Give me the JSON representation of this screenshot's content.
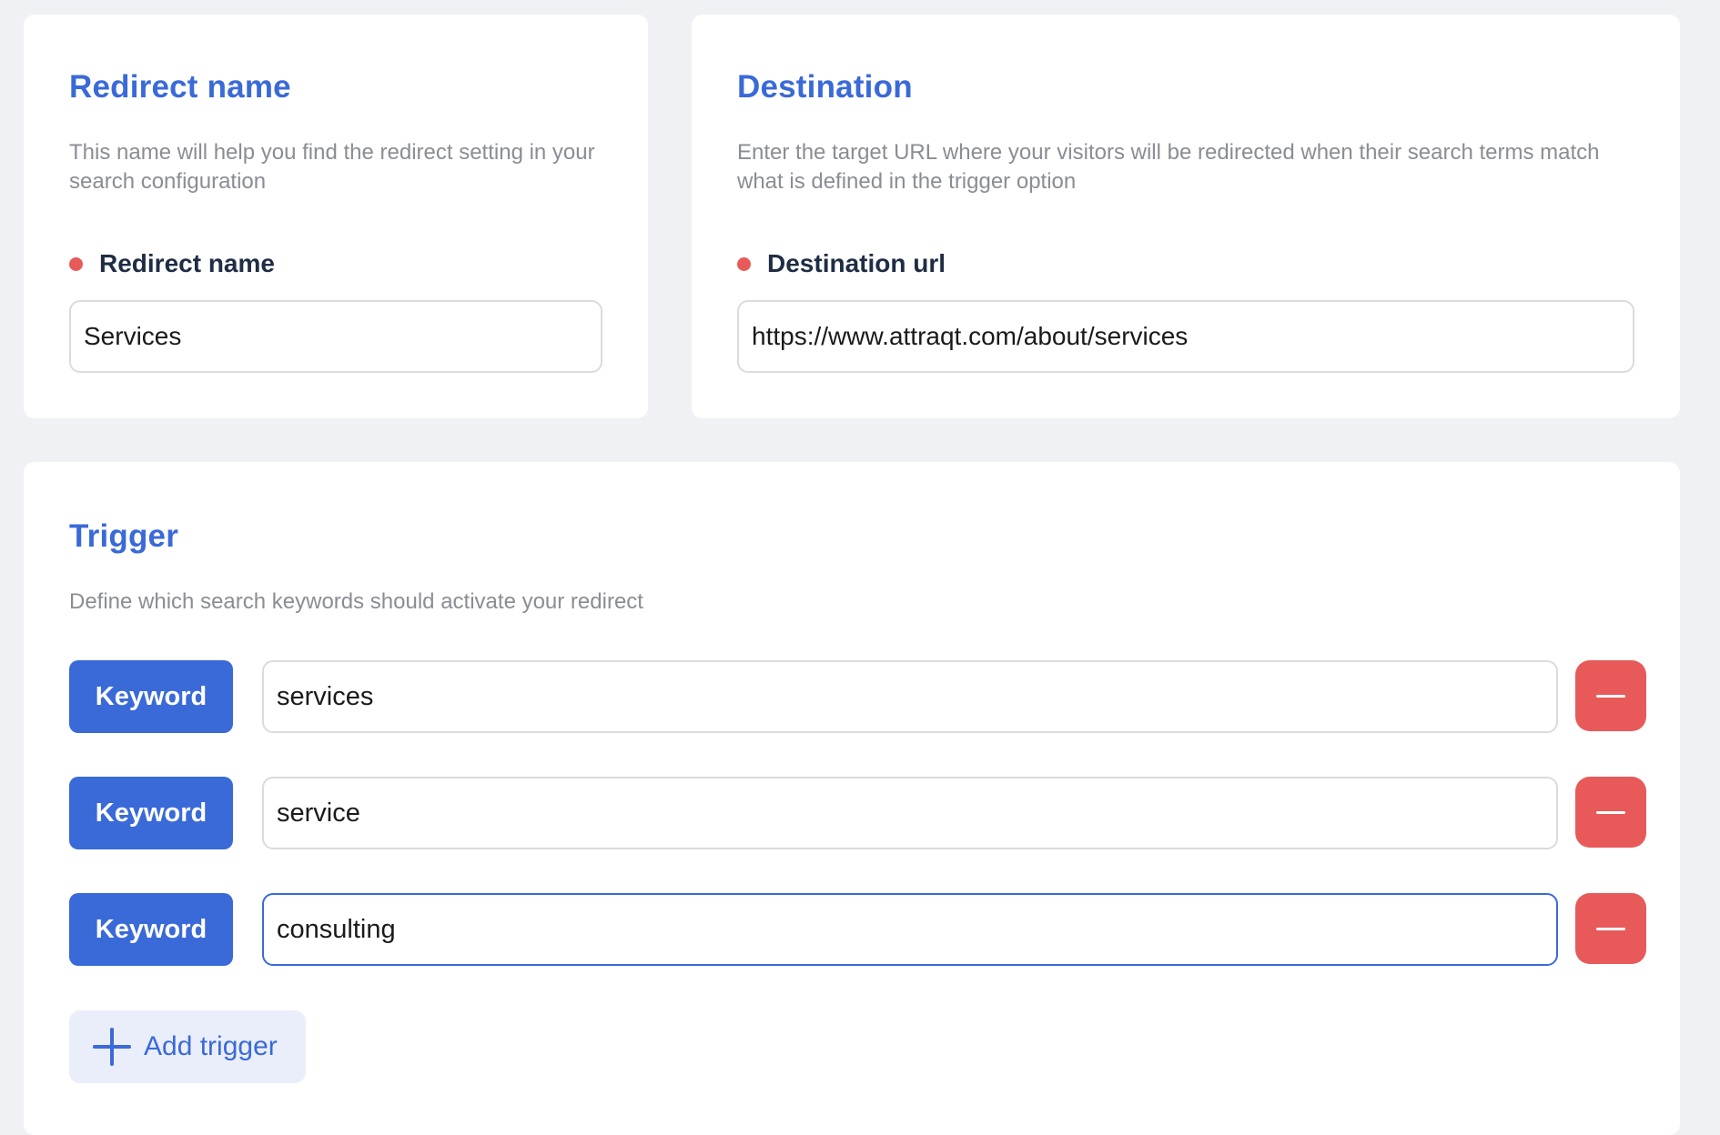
{
  "redirect_name_card": {
    "title": "Redirect name",
    "description": "This name will help you find the redirect setting in your search configuration",
    "field_label": "Redirect name",
    "value": "Services"
  },
  "destination_card": {
    "title": "Destination",
    "description": "Enter the target URL where your visitors will be redirected when their search terms match what is defined in the trigger option",
    "field_label": "Destination url",
    "value": "https://www.attraqt.com/about/services"
  },
  "trigger_card": {
    "title": "Trigger",
    "description": "Define which search keywords should activate your redirect",
    "rows": [
      {
        "type_label": "Keyword",
        "value": "services"
      },
      {
        "type_label": "Keyword",
        "value": "service"
      },
      {
        "type_label": "Keyword",
        "value": "consulting"
      }
    ],
    "add_label": "Add trigger"
  },
  "icons": {
    "remove": "minus-icon",
    "add": "plus-icon"
  },
  "colors": {
    "accent": "#3a6ad8",
    "danger": "#e85a5a",
    "background": "#f0f1f5"
  }
}
